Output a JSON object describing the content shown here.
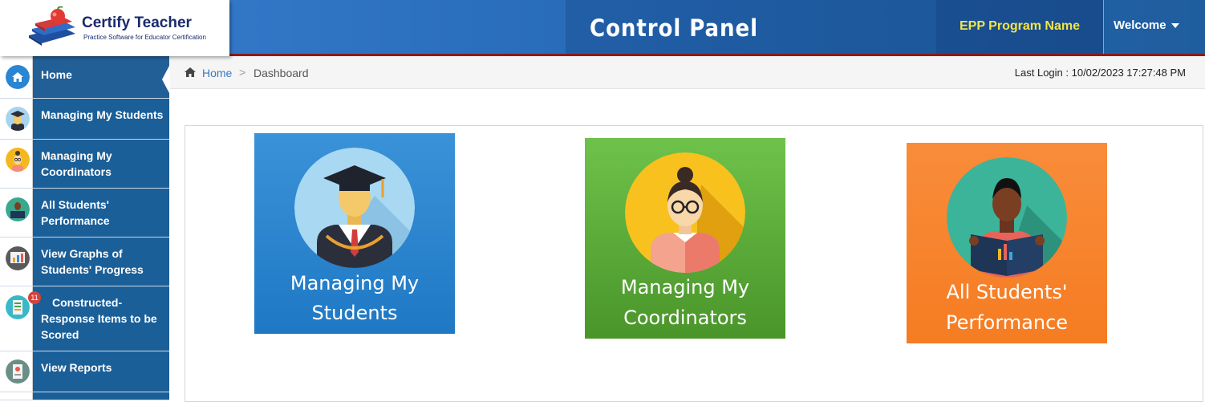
{
  "header": {
    "logo_title": "Certify Teacher",
    "logo_subtitle": "Practice Software for Educator Certification",
    "page_title": "Control Panel",
    "program_name": "EPP Program Name",
    "welcome_label": "Welcome"
  },
  "sidebar": {
    "items": [
      {
        "label": "Home",
        "icon": "home-icon",
        "active": true
      },
      {
        "label": "Managing My Students",
        "icon": "graduate-icon"
      },
      {
        "label": "Managing My Coordinators",
        "icon": "coordinator-icon"
      },
      {
        "label": "All Students' Performance",
        "icon": "reader-icon"
      },
      {
        "label": "View Graphs of Students' Progress",
        "icon": "chart-board-icon"
      },
      {
        "label": "Constructed-Response Items to be Scored",
        "icon": "checklist-icon",
        "badge": "11"
      },
      {
        "label": "View Reports",
        "icon": "report-icon"
      }
    ]
  },
  "breadcrumb": {
    "home": "Home",
    "separator": ">",
    "current": "Dashboard"
  },
  "last_login": "Last Login : 10/02/2023 17:27:48 PM",
  "tiles": [
    {
      "label_line1": "Managing My",
      "label_line2": "Students",
      "color": "#2a86d2",
      "icon": "graduate-icon"
    },
    {
      "label_line1": "Managing My",
      "label_line2": "Coordinators",
      "color": "#5aa53a",
      "icon": "coordinator-icon"
    },
    {
      "label_line1": "All Students'",
      "label_line2": "Performance",
      "color": "#f7822c",
      "icon": "reader-icon"
    }
  ],
  "colors": {
    "header_blue": "#2a6fbd",
    "sidebar_blue": "#1b5f98",
    "accent_red": "#8b1a1a",
    "program_yellow": "#f3e44a"
  }
}
